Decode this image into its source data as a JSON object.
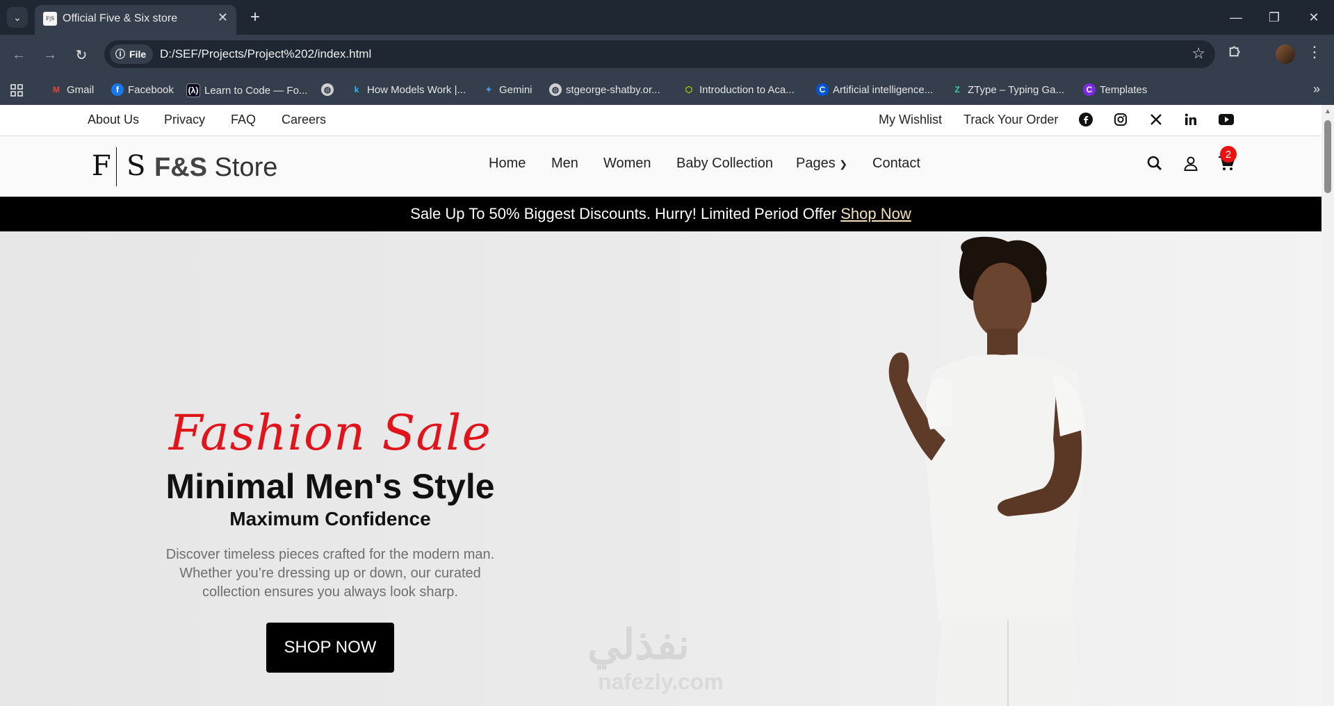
{
  "browser": {
    "tab_title": "Official Five & Six store",
    "favicon_text": "F|S",
    "url_chip": "File",
    "url": "D:/SEF/Projects/Project%202/index.html",
    "bookmarks": [
      {
        "label": "Gmail",
        "icon": "gmail-icon",
        "color": "#ea4335"
      },
      {
        "label": "Facebook",
        "icon": "facebook-icon",
        "color": "#1877f2"
      },
      {
        "label": "Learn to Code — Fo...",
        "icon": "freecodecamp-icon",
        "color": "#0a0a23"
      },
      {
        "label": "",
        "icon": "globe-icon",
        "color": "#cfcfcf"
      },
      {
        "label": "How Models Work |...",
        "icon": "kaggle-icon",
        "color": "#20beff"
      },
      {
        "label": "Gemini",
        "icon": "gemini-icon",
        "color": "#4796e3"
      },
      {
        "label": "stgeorge-shatby.or...",
        "icon": "globe-icon",
        "color": "#cfcfcf"
      },
      {
        "label": "Introduction to Aca...",
        "icon": "cube-icon",
        "color": "#a3d400"
      },
      {
        "label": "Artificial intelligence...",
        "icon": "coursera-icon",
        "color": "#0056d2"
      },
      {
        "label": "ZType – Typing Ga...",
        "icon": "ztype-icon",
        "color": "#3ad29f"
      },
      {
        "label": "Templates",
        "icon": "canva-icon",
        "color": "#7d2ae8"
      }
    ]
  },
  "topbar": {
    "left_links": [
      "About Us",
      "Privacy",
      "FAQ",
      "Careers"
    ],
    "right_links": [
      "My Wishlist",
      "Track Your Order"
    ],
    "social": [
      "facebook-icon",
      "instagram-icon",
      "x-icon",
      "linkedin-icon",
      "youtube-icon"
    ]
  },
  "header": {
    "logo_mark_f": "F",
    "logo_mark_s": "S",
    "logo_bold": "F&S",
    "logo_rest": " Store",
    "nav": [
      "Home",
      "Men",
      "Women",
      "Baby Collection",
      "Pages",
      "Contact"
    ],
    "cart_count": "2"
  },
  "promo": {
    "text": "Sale Up To 50% Biggest Discounts. Hurry! Limited Period Offer",
    "link": "Shop Now"
  },
  "hero": {
    "script_title": "Fashion Sale",
    "title": "Minimal Men's Style",
    "subtitle": "Maximum Confidence",
    "description": "Discover timeless pieces crafted for the modern man. Whether you’re dressing up or down, our curated collection ensures you always look sharp.",
    "button": "SHOP NOW",
    "watermark_ar": "نفذلي",
    "watermark_en": "nafezly.com"
  },
  "colors": {
    "accent_red": "#e0141a",
    "promo_bg": "#000000",
    "promo_link": "#f3e1b8",
    "browser_dark": "#1f2733"
  }
}
